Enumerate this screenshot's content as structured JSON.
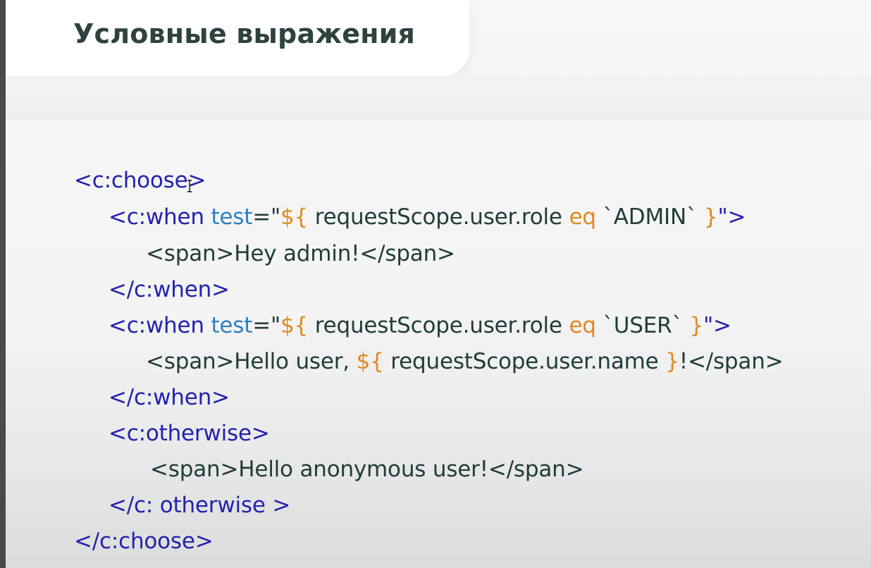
{
  "slide": {
    "title": "Условные выражения"
  },
  "code": {
    "line1": {
      "tag": "<c:choose>"
    },
    "line2": {
      "tag_open": "<c:when ",
      "attr": "test",
      "eq_quote": "=\"",
      "el_open": "${",
      "expr": " requestScope.user.role ",
      "op": "eq",
      "literal": " `ADMIN` ",
      "el_close": "}",
      "close": "\">"
    },
    "line3": {
      "text": "<span>Hey admin!</span>"
    },
    "line4": {
      "tag": "</c:when>"
    },
    "line5": {
      "tag_open": "<c:when ",
      "attr": "test",
      "eq_quote": "=\"",
      "el_open": "${",
      "expr": " requestScope.user.role ",
      "op": "eq",
      "literal": " `USER` ",
      "el_close": "}",
      "close": "\">"
    },
    "line6": {
      "text_before": "<span>Hello user, ",
      "el_open": "${",
      "expr": " requestScope.user.name ",
      "el_close": "}",
      "text_after": "!</span>"
    },
    "line7": {
      "tag": "</c:when>"
    },
    "line8": {
      "tag": "<c:otherwise>"
    },
    "line9": {
      "text": "<span>Hello anonymous user!</span>"
    },
    "line10": {
      "tag": "</c: otherwise >"
    },
    "line11": {
      "tag": "</c:choose>"
    }
  },
  "colors": {
    "tag": "#2222b0",
    "attribute": "#2e7fc0",
    "expression": "#e08a1e",
    "text": "#1f3c3a",
    "title": "#2e4340"
  },
  "icons": {
    "cursor": "text-cursor-icon"
  }
}
